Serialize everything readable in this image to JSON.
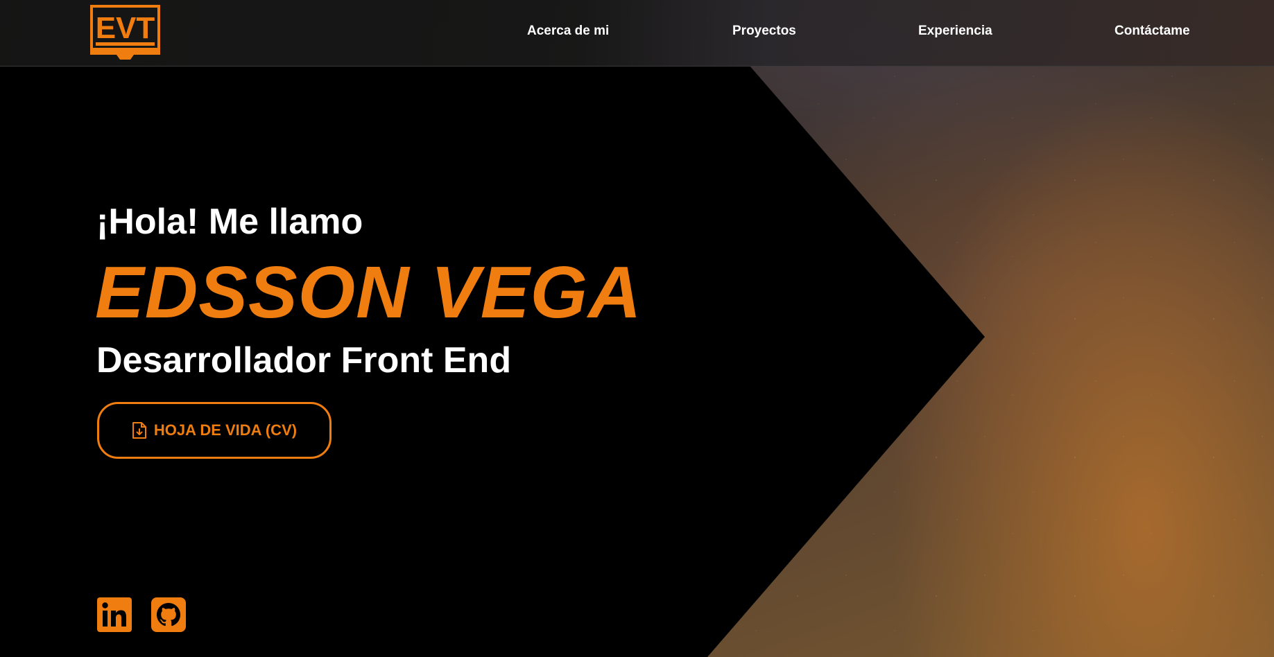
{
  "colors": {
    "accent": "#f07d0f",
    "text": "#ffffff",
    "background": "#000000"
  },
  "header": {
    "logo_icon": "monitor-logo-icon",
    "logo_text": "EVT",
    "nav": [
      {
        "label": "Acerca de mi"
      },
      {
        "label": "Proyectos"
      },
      {
        "label": "Experiencia"
      },
      {
        "label": "Contáctame"
      }
    ]
  },
  "hero": {
    "greeting": "¡Hola! Me llamo",
    "name": "EDSSON VEGA",
    "role": "Desarrollador Front End",
    "cv_button": {
      "label": "HOJA DE VIDA (CV)",
      "icon": "file-download-icon"
    }
  },
  "social": [
    {
      "icon": "linkedin-icon"
    },
    {
      "icon": "github-icon"
    }
  ]
}
